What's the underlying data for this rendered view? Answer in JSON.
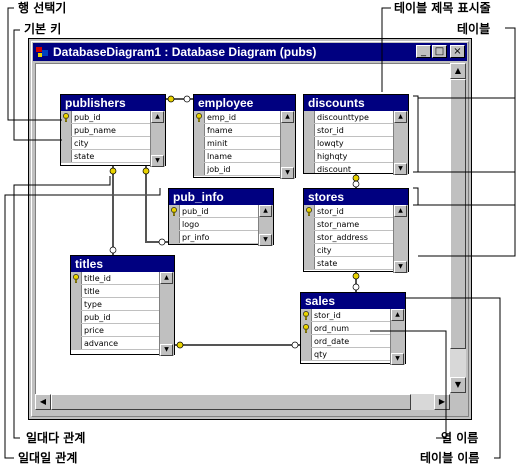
{
  "callouts": {
    "row_selector": "행 선택기",
    "primary_key": "기본 키",
    "table_title_display": "테이블 제목 표시줄",
    "table": "테이블",
    "one_to_many": "일대다 관계",
    "one_to_one": "일대일 관계",
    "column_name": "열 이름",
    "table_name": "테이블 이름"
  },
  "window": {
    "title": "DatabaseDiagram1 : Database Diagram (pubs)",
    "minimize": "_",
    "maximize": "□",
    "close": "×"
  },
  "tables": {
    "publishers": {
      "name": "publishers",
      "columns": [
        "pub_id",
        "pub_name",
        "city",
        "state"
      ]
    },
    "employee": {
      "name": "employee",
      "columns": [
        "emp_id",
        "fname",
        "minit",
        "lname",
        "job_id"
      ]
    },
    "discounts": {
      "name": "discounts",
      "columns": [
        "discounttype",
        "stor_id",
        "lowqty",
        "highqty",
        "discount"
      ]
    },
    "pub_info": {
      "name": "pub_info",
      "columns": [
        "pub_id",
        "logo",
        "pr_info"
      ]
    },
    "stores": {
      "name": "stores",
      "columns": [
        "stor_id",
        "stor_name",
        "stor_address",
        "city",
        "state"
      ]
    },
    "titles": {
      "name": "titles",
      "columns": [
        "title_id",
        "title",
        "type",
        "pub_id",
        "price",
        "advance"
      ]
    },
    "sales": {
      "name": "sales",
      "columns": [
        "stor_id",
        "ord_num",
        "ord_date",
        "qty"
      ]
    }
  },
  "colors": {
    "title_bar": "#000080",
    "window_face": "#c0c0c0",
    "canvas": "#ffffff",
    "key": "#e8d200"
  }
}
